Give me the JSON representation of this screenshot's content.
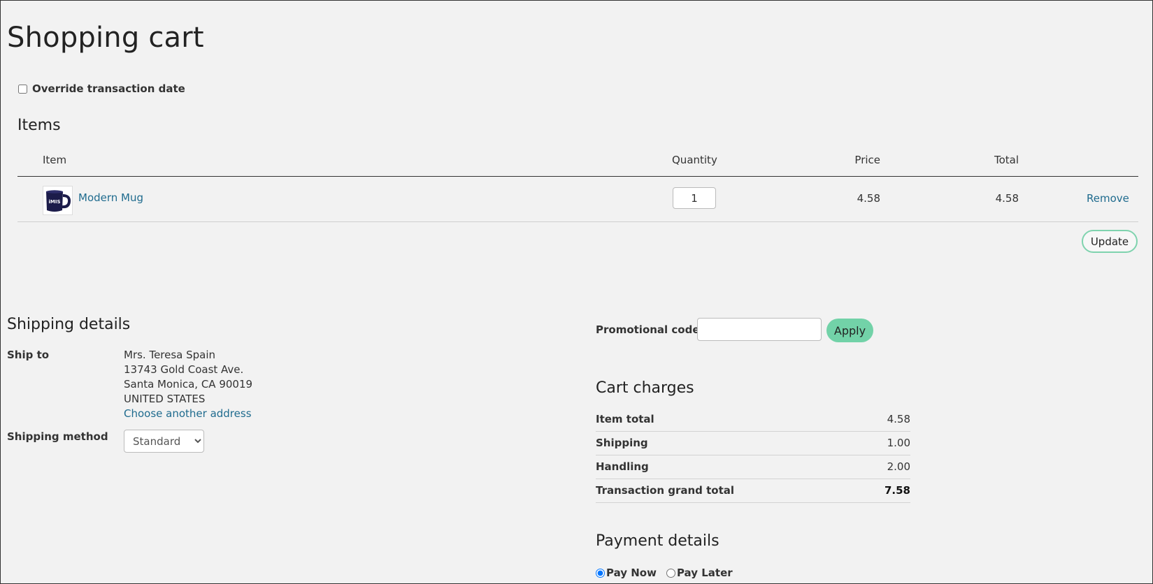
{
  "page": {
    "title": "Shopping cart"
  },
  "override": {
    "label": "Override transaction date",
    "checked": false
  },
  "items": {
    "heading": "Items",
    "columns": {
      "item": "Item",
      "quantity": "Quantity",
      "price": "Price",
      "total": "Total"
    },
    "rows": [
      {
        "name": "Modern Mug",
        "quantity": "1",
        "price": "4.58",
        "total": "4.58",
        "remove": "Remove",
        "image_text": "iMIS"
      }
    ],
    "update_label": "Update"
  },
  "shipping": {
    "heading": "Shipping details",
    "ship_to_label": "Ship to",
    "address": [
      "Mrs. Teresa Spain",
      "13743 Gold Coast Ave.",
      "Santa Monica, CA 90019",
      "UNITED STATES"
    ],
    "choose_link": "Choose another address",
    "method_label": "Shipping method",
    "method_value": "Standard"
  },
  "promo": {
    "label": "Promotional code",
    "value": "",
    "apply_label": "Apply"
  },
  "charges": {
    "heading": "Cart charges",
    "rows": [
      {
        "label": "Item total",
        "value": "4.58"
      },
      {
        "label": "Shipping",
        "value": "1.00"
      },
      {
        "label": "Handling",
        "value": "2.00"
      },
      {
        "label": "Transaction grand total",
        "value": "7.58"
      }
    ]
  },
  "payment": {
    "heading": "Payment details",
    "options": [
      {
        "label": "Pay Now",
        "checked": true
      },
      {
        "label": "Pay Later",
        "checked": false
      }
    ]
  },
  "colors": {
    "link": "#1f6b8e",
    "accent": "#72d2a8",
    "background": "#f2f2f2"
  }
}
